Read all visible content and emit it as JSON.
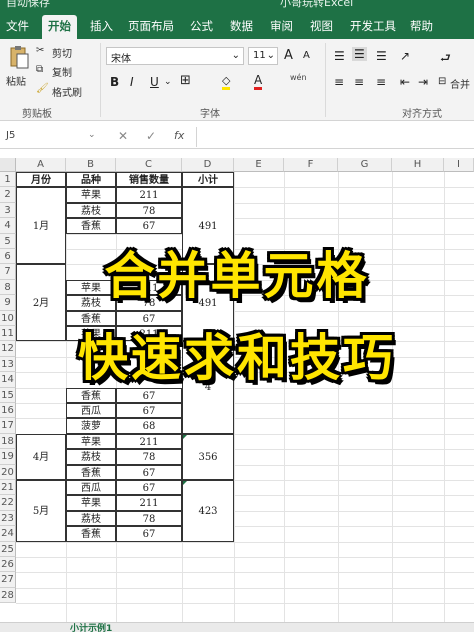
{
  "title_bar": {
    "autosave": "自动保存",
    "filename": "小哥玩转Excel"
  },
  "tabs": [
    "文件",
    "开始",
    "插入",
    "页面布局",
    "公式",
    "数据",
    "审阅",
    "视图",
    "开发工具",
    "帮助"
  ],
  "ribbon": {
    "paste": "粘贴",
    "cut": "剪切",
    "copy": "复制",
    "format_painter": "格式刷",
    "clipboard_group": "剪贴板",
    "font_name": "宋体",
    "font_size": "11",
    "grow_font": "A",
    "shrink_font": "A",
    "bold": "B",
    "italic": "I",
    "underline": "U",
    "font_color_letter": "A",
    "phonetic": "wén",
    "font_group": "字体",
    "merge_label": "合并",
    "align_group": "对齐方式"
  },
  "formula_bar": {
    "name_box": "J5",
    "fx": "fx"
  },
  "columns": [
    "A",
    "B",
    "C",
    "D",
    "E",
    "F",
    "G",
    "H",
    "I"
  ],
  "rows": [
    "1",
    "2",
    "3",
    "4",
    "5",
    "6",
    "7",
    "8",
    "9",
    "10",
    "11",
    "12",
    "13",
    "14",
    "15",
    "16",
    "17",
    "18",
    "19",
    "20",
    "21",
    "22",
    "23",
    "24",
    "25",
    "26",
    "27",
    "28"
  ],
  "table": {
    "headers": [
      "月份",
      "品种",
      "销售数量",
      "小计"
    ],
    "cells": [
      {
        "r": 2,
        "b": "苹果",
        "c": "211"
      },
      {
        "r": 3,
        "b": "荔枝",
        "c": "78"
      },
      {
        "r": 4,
        "b": "香蕉",
        "c": "67"
      },
      {
        "r": 8,
        "b": "苹果",
        "c": "211"
      },
      {
        "r": 9,
        "b": "荔枝",
        "c": "78"
      },
      {
        "r": 10,
        "b": "香蕉",
        "c": "67"
      },
      {
        "r": 11,
        "b": "苹果",
        "c": "211"
      },
      {
        "r": 15,
        "b": "香蕉",
        "c": "67"
      },
      {
        "r": 16,
        "b": "西瓜",
        "c": "67"
      },
      {
        "r": 17,
        "b": "菠萝",
        "c": "68"
      },
      {
        "r": 18,
        "b": "苹果",
        "c": "211"
      },
      {
        "r": 19,
        "b": "荔枝",
        "c": "78"
      },
      {
        "r": 20,
        "b": "香蕉",
        "c": "67"
      },
      {
        "r": 21,
        "b": "西瓜",
        "c": "67"
      },
      {
        "r": 22,
        "b": "苹果",
        "c": "211"
      },
      {
        "r": 23,
        "b": "荔枝",
        "c": "78"
      },
      {
        "r": 24,
        "b": "香蕉",
        "c": "67"
      }
    ],
    "merged": [
      {
        "col": "A",
        "from": 2,
        "to": 6,
        "text": "1月"
      },
      {
        "col": "A",
        "from": 7,
        "to": 11,
        "text": "2月"
      },
      {
        "col": "A",
        "from": 18,
        "to": 20,
        "text": "4月"
      },
      {
        "col": "A",
        "from": 21,
        "to": 24,
        "text": "5月"
      },
      {
        "col": "D",
        "from": 2,
        "to": 6,
        "text": "491"
      },
      {
        "col": "D",
        "from": 7,
        "to": 11,
        "text": "491"
      },
      {
        "col": "D",
        "from": 12,
        "to": 17,
        "text": "4"
      },
      {
        "col": "D",
        "from": 18,
        "to": 20,
        "text": "356"
      },
      {
        "col": "D",
        "from": 21,
        "to": 24,
        "text": "423"
      }
    ]
  },
  "overlay": {
    "line1": "合并单元格",
    "line2": "快速求和技巧"
  },
  "sheet_tab": "小计示例1",
  "colors": {
    "excel_green": "#1e7145",
    "overlay_yellow": "#ffe500"
  }
}
